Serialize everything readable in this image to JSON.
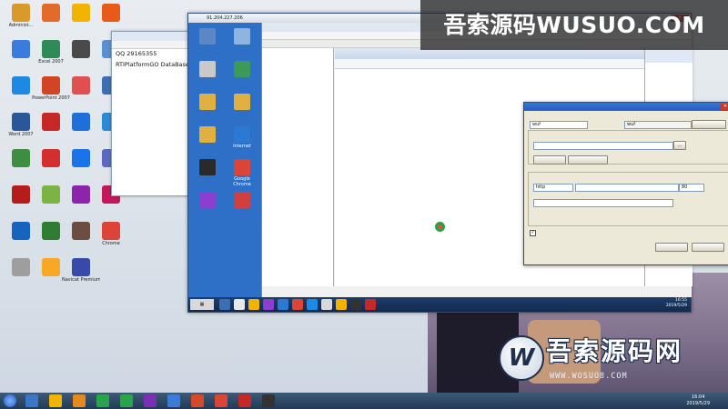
{
  "watermarks": {
    "top": "吾索源码WUSUO.COM",
    "bottom_big": "吾索源码网",
    "bottom_small": "WWW.WOSUO8.COM"
  },
  "desktop_icons": [
    {
      "label": "Administ...",
      "color": "#d89a2a"
    },
    {
      "label": "",
      "color": "#e36a2a"
    },
    {
      "label": "",
      "color": "#f2b400"
    },
    {
      "label": "",
      "color": "#e85a1a"
    },
    {
      "label": "",
      "color": "#3a7be0"
    },
    {
      "label": "Excel 2007",
      "color": "#2e8b57"
    },
    {
      "label": "",
      "color": "#4a4a4a"
    },
    {
      "label": "",
      "color": "#5a8fd0"
    },
    {
      "label": "",
      "color": "#1e88e5"
    },
    {
      "label": "PowerPoint 2007",
      "color": "#d14424"
    },
    {
      "label": "",
      "color": "#e05050"
    },
    {
      "label": "",
      "color": "#3d6fb0"
    },
    {
      "label": "Word 2007",
      "color": "#2b579a"
    },
    {
      "label": "",
      "color": "#c62828"
    },
    {
      "label": "",
      "color": "#1e6fd9"
    },
    {
      "label": "",
      "color": "#2a8ad4"
    },
    {
      "label": "",
      "color": "#3e8e41"
    },
    {
      "label": "",
      "color": "#d32f2f"
    },
    {
      "label": "",
      "color": "#1a73e8"
    },
    {
      "label": "",
      "color": "#5b6abf"
    },
    {
      "label": "",
      "color": "#b71c1c"
    },
    {
      "label": "",
      "color": "#7cb342"
    },
    {
      "label": "",
      "color": "#8e24aa"
    },
    {
      "label": "",
      "color": "#c2185b"
    },
    {
      "label": "",
      "color": "#1565c0"
    },
    {
      "label": "",
      "color": "#2e7d32"
    },
    {
      "label": "",
      "color": "#6d4c41"
    },
    {
      "label": "Chrome",
      "color": "#db4437"
    },
    {
      "label": "",
      "color": "#9e9e9e"
    },
    {
      "label": "",
      "color": "#f9a825"
    },
    {
      "label": "Navicat Premium",
      "color": "#3949ab"
    }
  ],
  "notepad": {
    "title": "",
    "menu": "",
    "lines": [
      "",
      "",
      "",
      "QQ 29165355",
      "",
      "",
      "",
      "RTIPlatformGO DataBaseIn",
      "",
      "",
      ""
    ]
  },
  "remote": {
    "title": "91.204.227.206",
    "desk_icons": [
      {
        "label": "",
        "color": "#5d86c5"
      },
      {
        "label": "",
        "color": "#8fb4e0"
      },
      {
        "label": "",
        "color": "#c9c9c9"
      },
      {
        "label": "",
        "color": "#3a9a5a"
      },
      {
        "label": "",
        "color": "#e0b040"
      },
      {
        "label": "",
        "color": "#e0b040"
      },
      {
        "label": "",
        "color": "#e0b040"
      },
      {
        "label": "Internet",
        "color": "#2a7ad4"
      },
      {
        "label": "",
        "color": "#2a2a2a"
      },
      {
        "label": "Google Chrome",
        "color": "#db4437"
      },
      {
        "label": "",
        "color": "#8a3fd0"
      },
      {
        "label": "",
        "color": "#d04040"
      }
    ],
    "clock": {
      "time": "16:55",
      "date": "2019/5/29"
    }
  },
  "iis": {
    "title": "",
    "menu": "",
    "tree": [
      "",
      "",
      "",
      "",
      "",
      "",
      "",
      ""
    ],
    "header": "",
    "crumb": "",
    "bottom_tabs": "",
    "actions": [
      {
        "type": "head",
        "text": ""
      },
      {
        "type": "item",
        "text": ""
      },
      {
        "type": "item",
        "text": ""
      },
      {
        "type": "item",
        "text": ""
      },
      {
        "type": "item",
        "text": ""
      },
      {
        "type": "item",
        "text": ""
      },
      {
        "type": "head",
        "text": ""
      },
      {
        "type": "item",
        "text": ""
      }
    ]
  },
  "dialog": {
    "title": "",
    "site_name_label": "",
    "site_name_value": "wuf",
    "app_pool_label": "",
    "app_pool_value": "wuf",
    "select_btn": "",
    "content_dir_label": "",
    "physical_path_label": "",
    "auth_label": "",
    "connect_as_btn": "",
    "test_settings_btn": "",
    "binding_label": "",
    "type_label": "",
    "type_value": "http",
    "ip_label": "",
    "ip_value": "",
    "port_label": "",
    "port_value": "80",
    "host_label": "",
    "example": "",
    "start_label": "",
    "ok_btn": "",
    "cancel_btn": ""
  },
  "taskbar": {
    "icons": [
      {
        "color": "#3b77c4"
      },
      {
        "color": "#f2b400"
      },
      {
        "color": "#e58a1a"
      },
      {
        "color": "#2aa44a"
      },
      {
        "color": "#2aa44a"
      },
      {
        "color": "#7a2fb5"
      },
      {
        "color": "#3d7bd6"
      },
      {
        "color": "#d64a2a"
      },
      {
        "color": "#db4437"
      },
      {
        "color": "#c62828"
      },
      {
        "color": "#333333"
      }
    ],
    "clock": {
      "time": "16:04",
      "date": "2019/5/29"
    }
  }
}
